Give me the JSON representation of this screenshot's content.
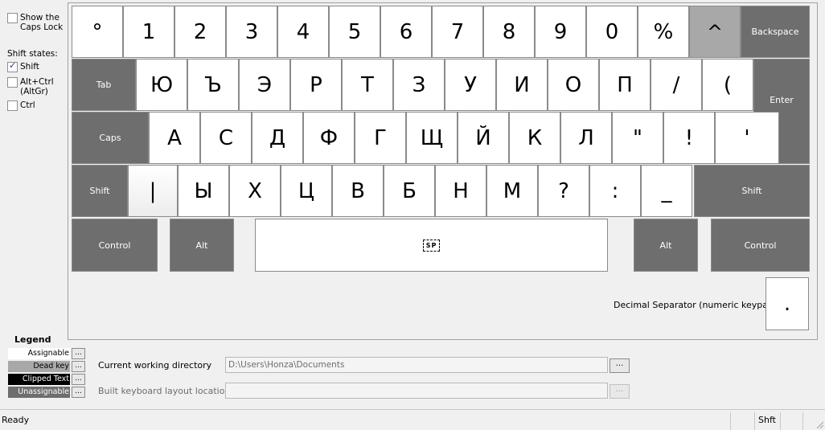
{
  "options": {
    "show_caps_lock": "Show the Caps Lock",
    "shift_states_label": "Shift states:",
    "shift": "Shift",
    "altgr": "Alt+Ctrl (AltGr)",
    "ctrl": "Ctrl"
  },
  "keyboard": {
    "row1": [
      "°",
      "1",
      "2",
      "3",
      "4",
      "5",
      "6",
      "7",
      "8",
      "9",
      "0",
      "%",
      "^",
      "Backspace"
    ],
    "row2": [
      "Tab",
      "Ю",
      "Ъ",
      "Э",
      "Р",
      "Т",
      "З",
      "У",
      "И",
      "О",
      "П",
      "/",
      "("
    ],
    "enter": "Enter",
    "row3": [
      "Caps",
      "А",
      "С",
      "Д",
      "Ф",
      "Г",
      "Щ",
      "Й",
      "К",
      "Л",
      "\"",
      "!",
      "'"
    ],
    "row4": [
      "Shift",
      "|",
      "Ы",
      "Х",
      "Ц",
      "В",
      "Б",
      "Н",
      "М",
      "?",
      ":",
      "_",
      "Shift"
    ],
    "row5": {
      "ctrl_left": "Control",
      "alt_left": "Alt",
      "space": "SP",
      "alt_right": "Alt",
      "ctrl_right": "Control"
    },
    "decimal_label": "Decimal Separator (numeric keypad)",
    "decimal_key": "."
  },
  "legend": {
    "title": "Legend",
    "items": [
      {
        "label": "Assignable",
        "bg": "#ffffff",
        "fg": "#000000"
      },
      {
        "label": "Dead key",
        "bg": "#a8a8a8",
        "fg": "#000000"
      },
      {
        "label": "Clipped Text",
        "bg": "#000000",
        "fg": "#ffffff"
      },
      {
        "label": "Unassignable",
        "bg": "#6e6e6e",
        "fg": "#ffffff"
      }
    ],
    "button": "..."
  },
  "paths": {
    "cwd_label": "Current working directory",
    "cwd_value": "D:\\Users\\Honza\\Documents",
    "build_label": "Built keyboard layout location",
    "build_value": "",
    "browse": "..."
  },
  "status": {
    "text": "Ready",
    "shift": "Shft"
  }
}
